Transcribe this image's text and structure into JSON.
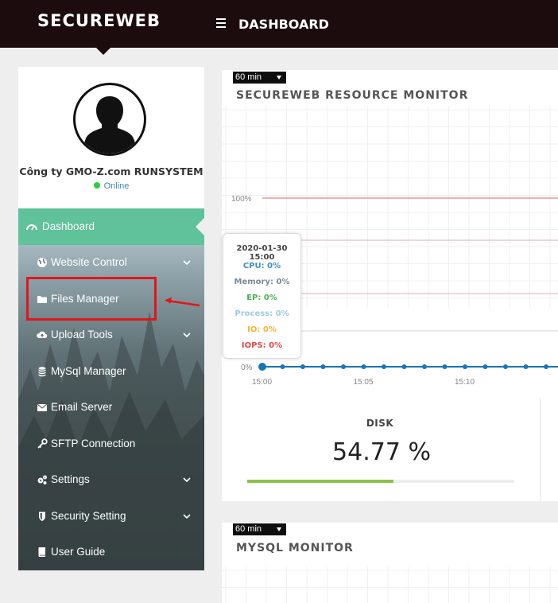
{
  "header": {
    "brand": "SECUREWEB",
    "page_title": "DASHBOARD"
  },
  "profile": {
    "company": "Công ty GMO-Z.com RUNSYSTEM",
    "status": "Online"
  },
  "sidebar": {
    "items": [
      {
        "label": "Dashboard",
        "icon": "gauge-icon",
        "expandable": false
      },
      {
        "label": "Website Control",
        "icon": "globe-icon",
        "expandable": true
      },
      {
        "label": "Files Manager",
        "icon": "folder-icon",
        "expandable": false
      },
      {
        "label": "Upload Tools",
        "icon": "cloud-upload-icon",
        "expandable": true
      },
      {
        "label": "MySql Manager",
        "icon": "database-icon",
        "expandable": false
      },
      {
        "label": "Email Server",
        "icon": "envelope-icon",
        "expandable": false
      },
      {
        "label": "SFTP Connection",
        "icon": "key-icon",
        "expandable": false
      },
      {
        "label": "Settings",
        "icon": "gears-icon",
        "expandable": true
      },
      {
        "label": "Security Setting",
        "icon": "shield-icon",
        "expandable": true
      },
      {
        "label": "User Guide",
        "icon": "book-icon",
        "expandable": false
      }
    ]
  },
  "resource_monitor": {
    "range": "60 min",
    "title": "SECUREWEB RESOURCE MONITOR",
    "tooltip": {
      "time": "2020-01-30 15:00",
      "cpu": "CPU: 0%",
      "memory": "Memory: 0%",
      "ep": "EP: 0%",
      "process": "Process: 0%",
      "io": "IO: 0%",
      "iops": "IOPS: 0%"
    }
  },
  "disk": {
    "label": "DISK",
    "value": "54.77 %",
    "percent": 54.77
  },
  "mysql_monitor": {
    "range": "60 min",
    "title": "MYSQL MONITOR"
  },
  "colors": {
    "topbar": "#1c0c0d",
    "active": "#5fc29a",
    "highlight": "#e3151c",
    "cpu": "#3b8fc2",
    "memory": "#7a8a96",
    "ep": "#4caf50",
    "process": "#9ecbe6",
    "io": "#f2b430",
    "iops": "#e04848",
    "line": "#1776b8",
    "disk_bar": "#8bc34a"
  },
  "chart_data": {
    "type": "line",
    "x": [
      "15:00",
      "15:01",
      "15:02",
      "15:03",
      "15:04",
      "15:05",
      "15:06",
      "15:07",
      "15:08",
      "15:09",
      "15:10",
      "15:11",
      "15:12",
      "15:13",
      "15:14",
      "15:15"
    ],
    "x_ticks": [
      "15:00",
      "15:05",
      "15:10"
    ],
    "series": [
      {
        "name": "CPU",
        "values": [
          0,
          0,
          0,
          0,
          0,
          0,
          0,
          0,
          0,
          0,
          0,
          0,
          0,
          0,
          0,
          0
        ]
      }
    ],
    "y_ticks": [
      "0%",
      "25%",
      "75%",
      "100%"
    ],
    "ylim": [
      0,
      100
    ],
    "grid": true
  }
}
